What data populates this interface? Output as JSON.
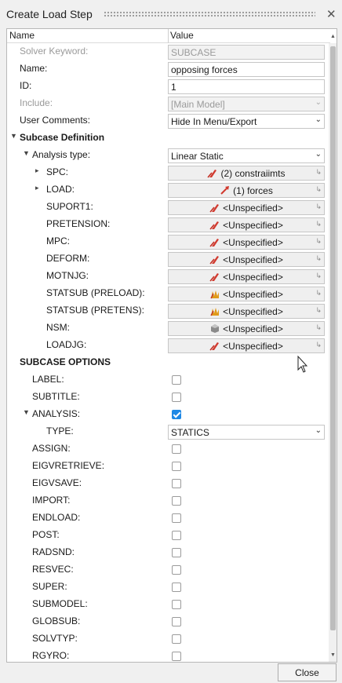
{
  "window": {
    "title": "Create Load Step"
  },
  "columns": {
    "name": "Name",
    "value": "Value"
  },
  "fields": {
    "solver_keyword": {
      "label": "Solver Keyword:",
      "value": "SUBCASE"
    },
    "name": {
      "label": "Name:",
      "value": "opposing forces"
    },
    "id": {
      "label": "ID:",
      "value": "1"
    },
    "include": {
      "label": "Include:",
      "value": "[Main Model]"
    },
    "user_comments": {
      "label": "User Comments:",
      "value": "Hide In Menu/Export"
    }
  },
  "subcase_definition": {
    "label": "Subcase Definition",
    "analysis_type": {
      "label": "Analysis type:",
      "value": "Linear Static"
    },
    "spc": {
      "label": "SPC:",
      "value": "(2) constraiimts"
    },
    "load": {
      "label": "LOAD:",
      "value": "(1) forces"
    },
    "suport1": {
      "label": "SUPORT1:",
      "value": "<Unspecified>"
    },
    "pretension": {
      "label": "PRETENSION:",
      "value": "<Unspecified>"
    },
    "mpc": {
      "label": "MPC:",
      "value": "<Unspecified>"
    },
    "deform": {
      "label": "DEFORM:",
      "value": "<Unspecified>"
    },
    "motnjg": {
      "label": "MOTNJG:",
      "value": "<Unspecified>"
    },
    "statsub_preload": {
      "label": "STATSUB (PRELOAD):",
      "value": "<Unspecified>"
    },
    "statsub_pretens": {
      "label": "STATSUB (PRETENS):",
      "value": "<Unspecified>"
    },
    "nsm": {
      "label": "NSM:",
      "value": "<Unspecified>"
    },
    "loadjg": {
      "label": "LOADJG:",
      "value": "<Unspecified>"
    }
  },
  "subcase_options": {
    "label": "SUBCASE OPTIONS",
    "label_opt": {
      "label": "LABEL:",
      "checked": false
    },
    "subtitle": {
      "label": "SUBTITLE:",
      "checked": false
    },
    "analysis": {
      "label": "ANALYSIS:",
      "checked": true
    },
    "type": {
      "label": "TYPE:",
      "value": "STATICS"
    },
    "assign": {
      "label": "ASSIGN:",
      "checked": false
    },
    "eigvretrieve": {
      "label": "EIGVRETRIEVE:",
      "checked": false
    },
    "eigvsave": {
      "label": "EIGVSAVE:",
      "checked": false
    },
    "import": {
      "label": "IMPORT:",
      "checked": false
    },
    "endload": {
      "label": "ENDLOAD:",
      "checked": false
    },
    "post": {
      "label": "POST:",
      "checked": false
    },
    "radsnd": {
      "label": "RADSND:",
      "checked": false
    },
    "resvec": {
      "label": "RESVEC:",
      "checked": false
    },
    "super": {
      "label": "SUPER:",
      "checked": false
    },
    "submodel": {
      "label": "SUBMODEL:",
      "checked": false
    },
    "globsub": {
      "label": "GLOBSUB:",
      "checked": false
    },
    "solvtyp": {
      "label": "SOLVTYP:",
      "checked": false
    },
    "rgyro": {
      "label": "RGYRO:",
      "checked": false
    }
  },
  "buttons": {
    "close": "Close"
  },
  "icons": {
    "constraint": "constraint-icon",
    "force": "force-icon",
    "statsub": "statsub-icon",
    "nsm": "nsm-icon",
    "pointer": "entity-pointer-icon"
  },
  "colors": {
    "accent": "#1e88e5",
    "constraint_icon": "#d13a2f",
    "statsub_icon": "#e09a1a"
  }
}
